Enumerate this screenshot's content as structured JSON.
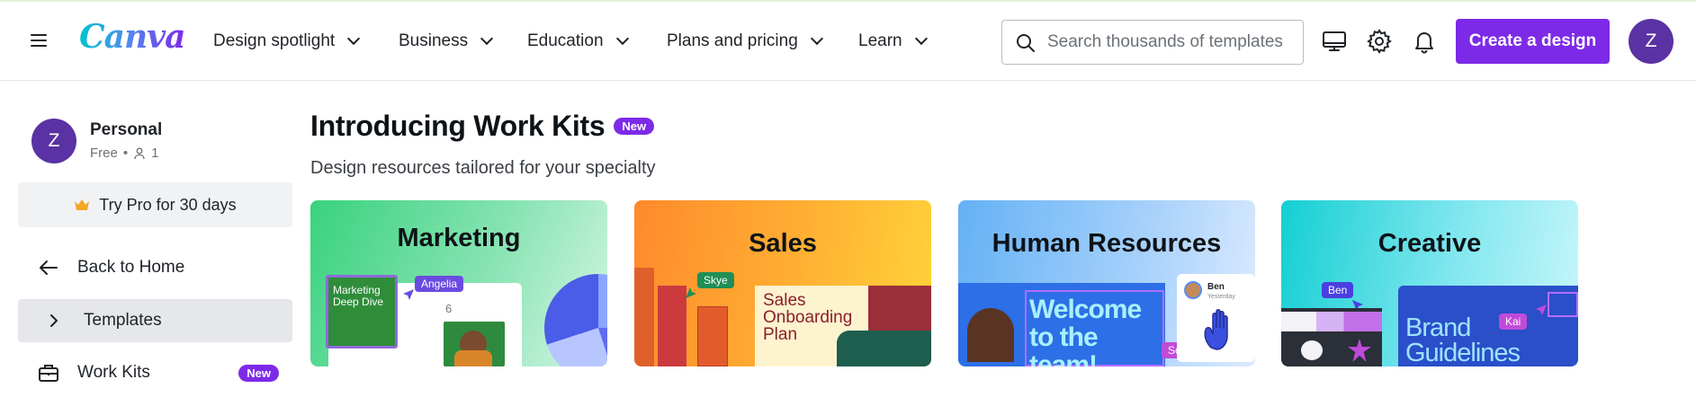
{
  "header": {
    "logo": "Canva",
    "nav": [
      {
        "label": "Design spotlight"
      },
      {
        "label": "Business"
      },
      {
        "label": "Education"
      },
      {
        "label": "Plans and pricing"
      },
      {
        "label": "Learn"
      }
    ],
    "search": {
      "placeholder": "Search thousands of templates",
      "value": ""
    },
    "icons": [
      "desktop-icon",
      "gear-icon",
      "bell-icon"
    ],
    "create_button": "Create a design",
    "avatar_initial": "Z"
  },
  "sidebar": {
    "account": {
      "initial": "Z",
      "name": "Personal",
      "plan": "Free",
      "members": "1"
    },
    "try_pro": "Try Pro for 30 days",
    "items": [
      {
        "label": "Back to Home",
        "icon": "arrow-left-icon"
      },
      {
        "label": "Templates",
        "icon": "chevron-right-icon",
        "active": true
      },
      {
        "label": "Work Kits",
        "icon": "briefcase-icon",
        "badge": "New"
      }
    ]
  },
  "main": {
    "title": "Introducing Work Kits",
    "title_badge": "New",
    "subtitle": "Design resources tailored for your specialty",
    "cards": [
      {
        "title": "Marketing",
        "art": {
          "poster": "Marketing Deep Dive",
          "chip": "Angelia",
          "page_number": "6"
        }
      },
      {
        "title": "Sales",
        "art": {
          "poster": "Sales Onboarding Plan",
          "chip": "Skye"
        }
      },
      {
        "title": "Human Resources",
        "art": {
          "poster": "Welcome to the team!",
          "chip": "Sonja",
          "comment_author": "Ben",
          "comment_time": "Yesterday"
        }
      },
      {
        "title": "Creative",
        "art": {
          "poster": "Brand Guidelines",
          "chip_1": "Ben",
          "chip_2": "Kai"
        }
      }
    ]
  },
  "colors": {
    "brand_purple": "#7d2ae8",
    "avatar_purple": "#5a32a3"
  }
}
